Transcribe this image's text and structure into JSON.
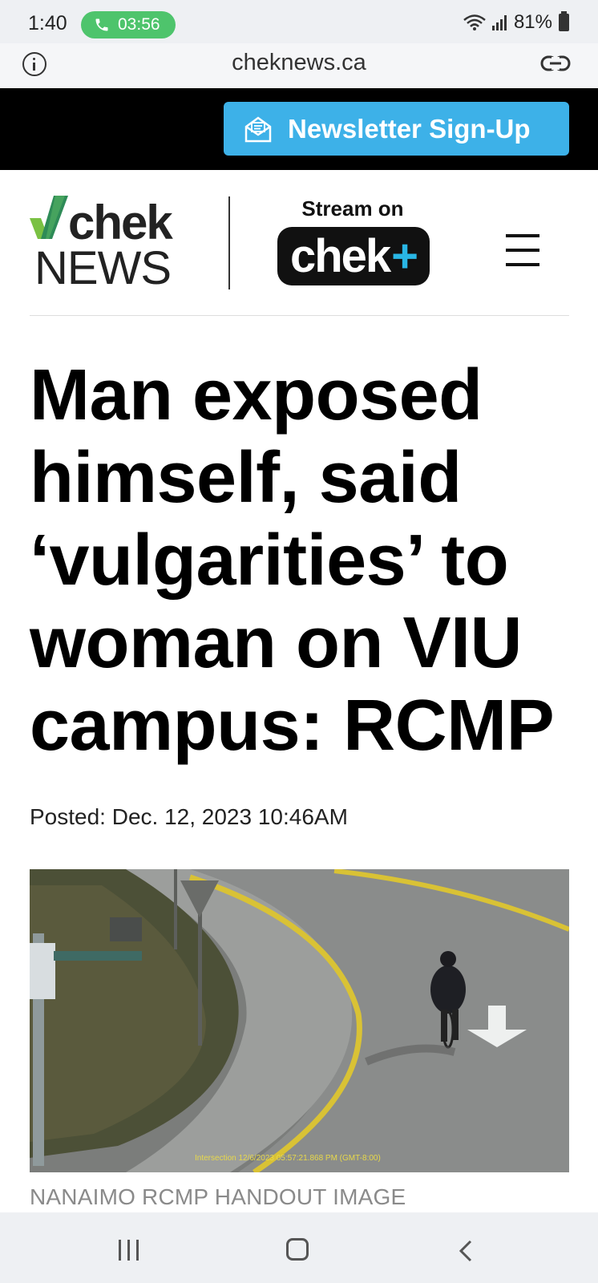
{
  "status_bar": {
    "time": "1:40",
    "call_duration": "03:56",
    "battery": "81%",
    "call_color": "#4ec46c"
  },
  "browser": {
    "url": "cheknews.ca",
    "info_icon": "info-icon",
    "share_icon": "link-icon"
  },
  "banner": {
    "newsletter_label": "Newsletter Sign-Up",
    "button_color": "#3db1e8"
  },
  "header": {
    "logo_top": "chek",
    "logo_bottom": "NEWS",
    "stream_label": "Stream on",
    "chekplus_text": "chek",
    "chekplus_plus": "+",
    "menu_icon": "hamburger-icon"
  },
  "article": {
    "headline": "Man exposed himself, said ‘vulgarities’ to woman on VIU campus: RCMP",
    "posted": "Posted: Dec. 12, 2023 10:46AM",
    "image_stamp": "Intersection 12/6/2023 05:57:21.868 PM (GMT-8:00)",
    "image_caption": "NANAIMO RCMP HANDOUT IMAGE"
  },
  "nav": {
    "recents": "recents-icon",
    "home": "home-icon",
    "back": "back-icon"
  }
}
